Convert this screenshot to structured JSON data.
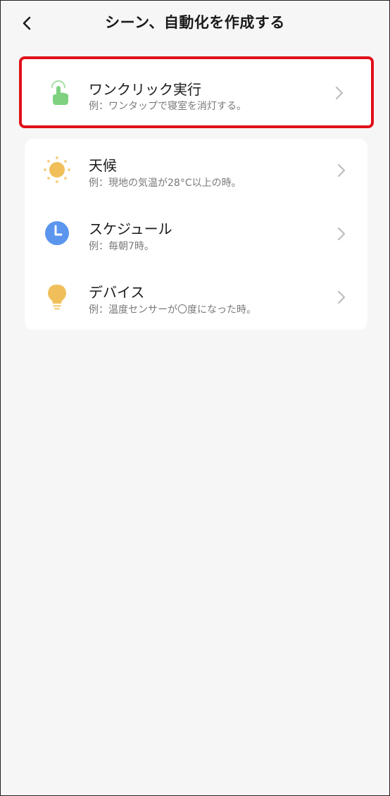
{
  "header": {
    "title": "シーン、自動化を作成する",
    "back_icon": "chevron-left-icon"
  },
  "one_click": {
    "title": "ワンクリック実行",
    "subtitle": "例：ワンタップで寝室を消灯する。",
    "icon": "tap-hand-icon",
    "highlight_color": "#e0101a",
    "icon_color": "#7fd17f"
  },
  "conditions": [
    {
      "title": "天候",
      "subtitle": "例：現地の気温が28°C以上の時。",
      "icon": "sun-icon",
      "icon_color": "#f0bf5a"
    },
    {
      "title": "スケジュール",
      "subtitle": "例：毎朝7時。",
      "icon": "clock-icon",
      "icon_color": "#5b95ee"
    },
    {
      "title": "デバイス",
      "subtitle": "例：温度センサーが〇度になった時。",
      "icon": "lightbulb-icon",
      "icon_color": "#f0bf5a"
    }
  ]
}
